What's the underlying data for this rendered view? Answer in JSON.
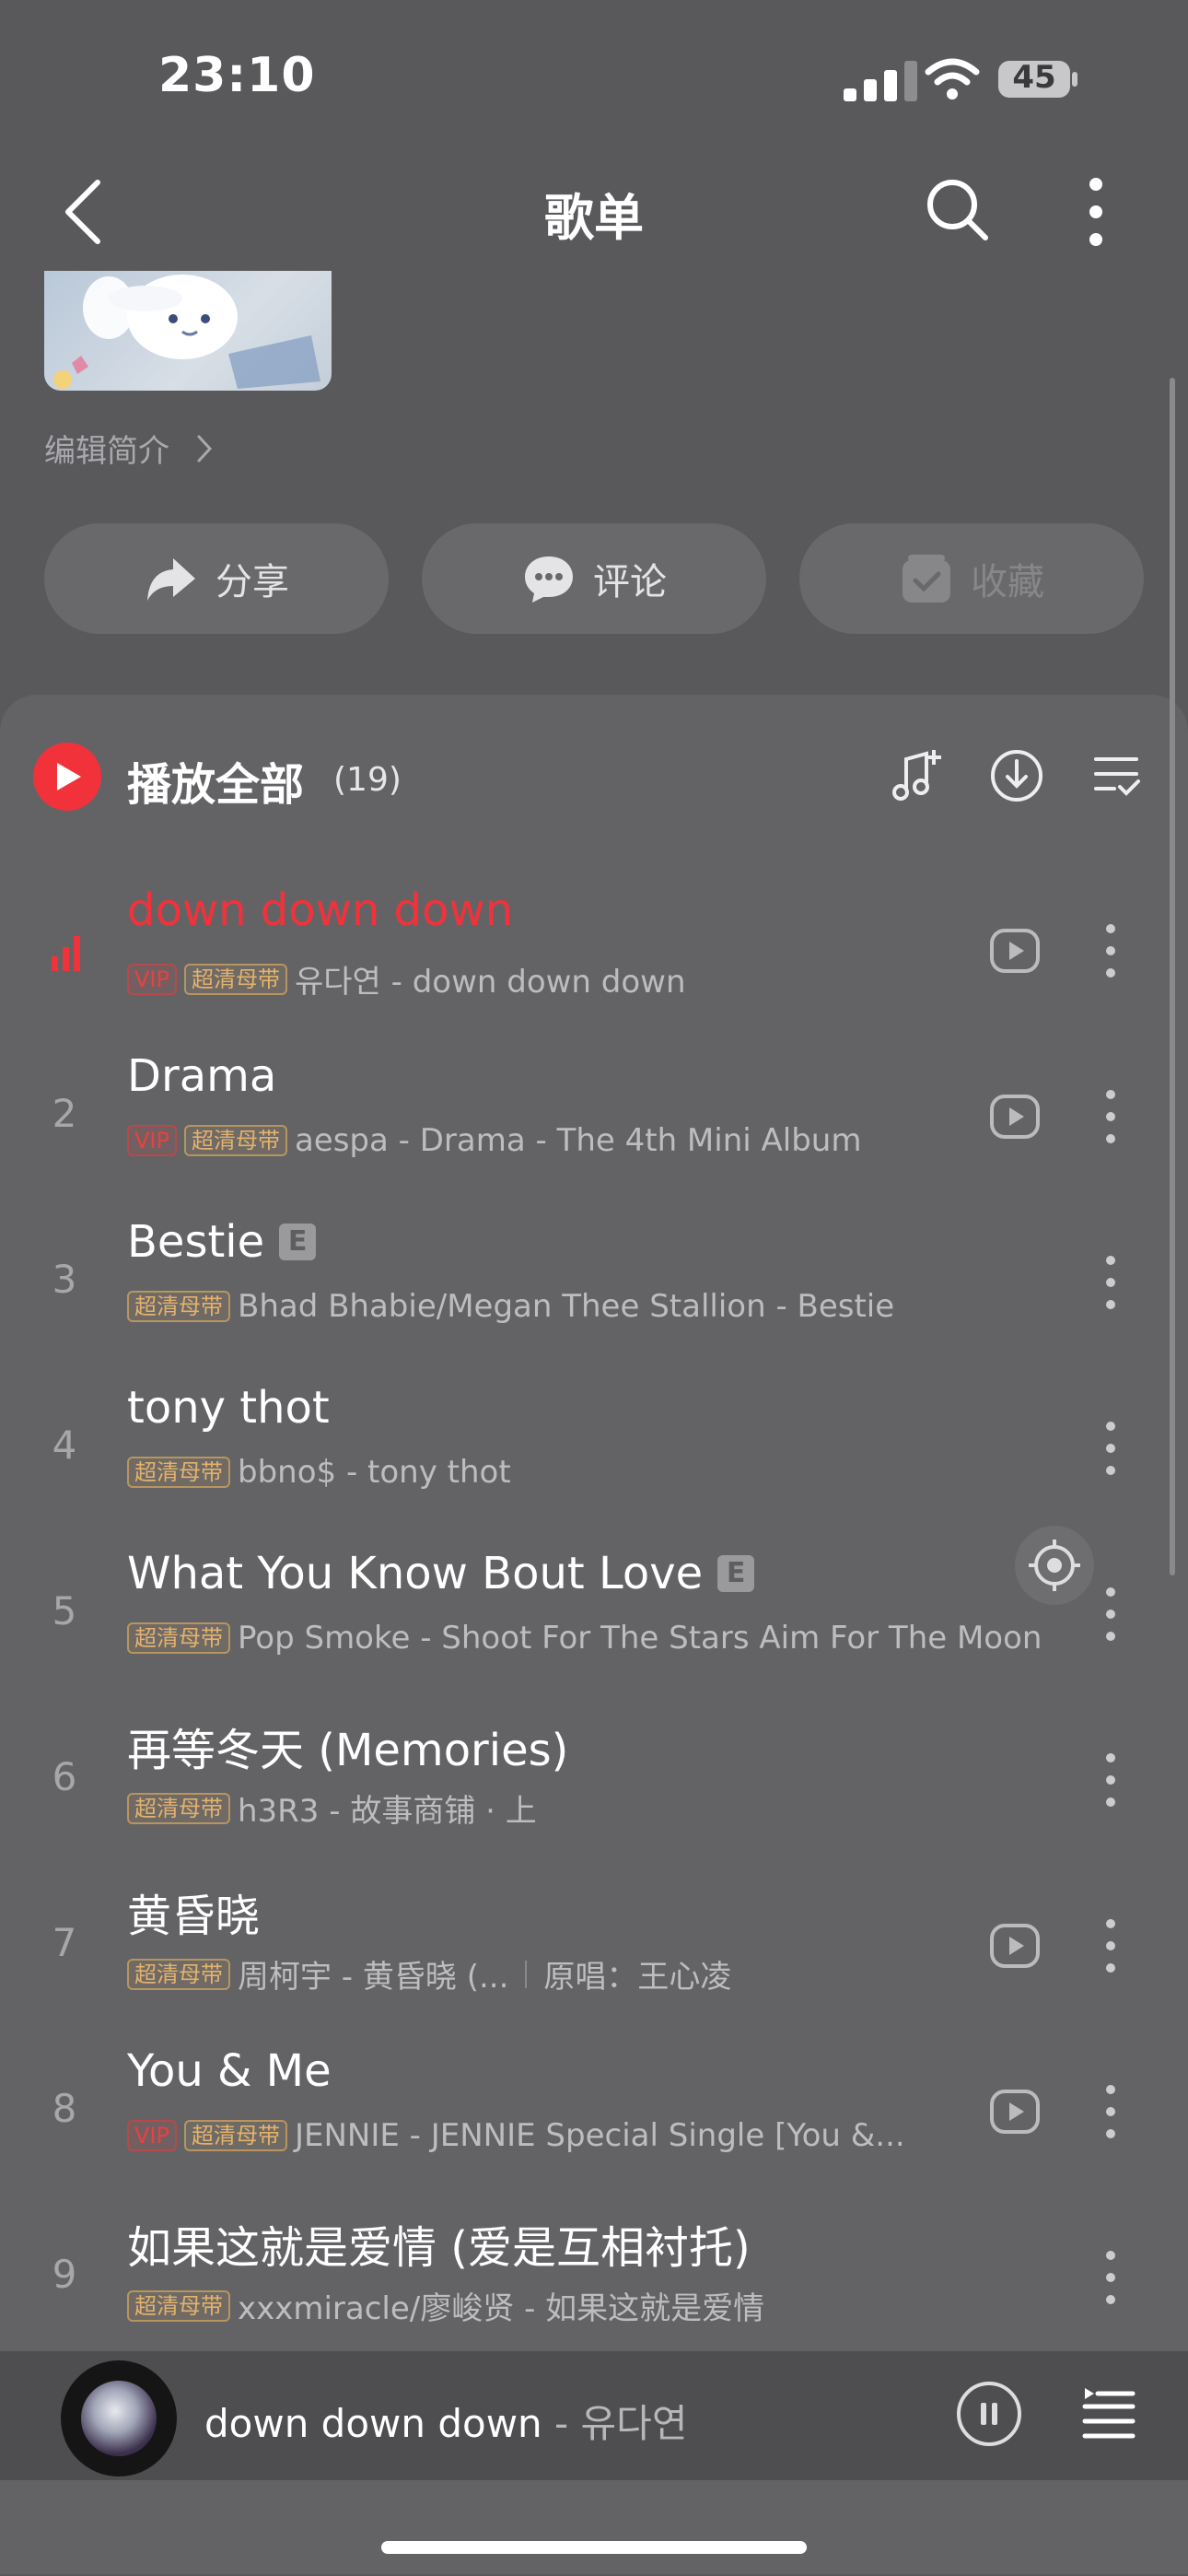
{
  "status": {
    "time": "23:10",
    "battery": "45"
  },
  "nav": {
    "title": "歌单"
  },
  "intro": {
    "label": "编辑简介"
  },
  "actions": {
    "share": "分享",
    "comment": "评论",
    "favorite": "收藏"
  },
  "list_header": {
    "play_all": "播放全部",
    "count": "(19)"
  },
  "songs": [
    {
      "num": "",
      "title": "down down down",
      "vip": "VIP",
      "hq": "超清母带",
      "subtitle": "유다연 - down down down"
    },
    {
      "num": "2",
      "title": "Drama",
      "vip": "VIP",
      "hq": "超清母带",
      "subtitle": "aespa - Drama - The 4th Mini Album"
    },
    {
      "num": "3",
      "title": "Bestie",
      "explicit": "E",
      "hq": "超清母带",
      "subtitle": "Bhad Bhabie/Megan Thee Stallion - Bestie"
    },
    {
      "num": "4",
      "title": "tony thot",
      "hq": "超清母带",
      "subtitle": "bbno$ - tony thot"
    },
    {
      "num": "5",
      "title": "What You Know Bout Love",
      "explicit": "E",
      "hq": "超清母带",
      "subtitle": "Pop Smoke - Shoot For The Stars Aim For The Moon"
    },
    {
      "num": "6",
      "title": "再等冬天 (Memories)",
      "hq": "超清母带",
      "subtitle": "h3R3 - 故事商铺 · 上"
    },
    {
      "num": "7",
      "title": "黄昏晓",
      "hq": "超清母带",
      "subtitle": "周柯宇 - 黄昏晓 (...",
      "extra": "原唱：王心凌"
    },
    {
      "num": "8",
      "title": "You & Me",
      "vip": "VIP",
      "hq": "超清母带",
      "subtitle": "JENNIE - JENNIE Special Single [You &..."
    },
    {
      "num": "9",
      "title": "如果这就是爱情 (爱是互相衬托)",
      "hq": "超清母带",
      "subtitle": "xxxmiracle/廖峻贤 - 如果这就是爱情"
    }
  ],
  "player": {
    "title": "down down down",
    "separator": " - ",
    "artist": "유다연"
  },
  "colors": {
    "accent": "#f2323b",
    "background": "#59595c",
    "panel": "#636366"
  }
}
